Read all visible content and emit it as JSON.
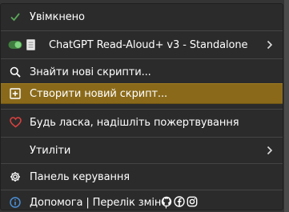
{
  "menu": {
    "enabled_label": "Увімкнено",
    "script_name": "ChatGPT Read-Aloud+ v3 - Standalone",
    "find_scripts": "Знайти нові скрипти...",
    "create_script": "Створити новий скрипт...",
    "donate": "Будь ласка, надішліть пожертвування",
    "utilities": "Утиліти",
    "dashboard": "Панель керування",
    "help": "Допомога | Перелік змін |"
  },
  "colors": {
    "check": "#5aa55a",
    "toggle": "#4caf50",
    "heart": "#d9413f",
    "info": "#4a90d9",
    "highlight": "#8a6a1a"
  },
  "icons": {
    "enabled": "check-icon",
    "script": "toggle-icon",
    "find": "search-icon",
    "create": "plus-square-icon",
    "donate": "heart-icon",
    "dashboard": "gear-icon",
    "help": "info-icon"
  }
}
